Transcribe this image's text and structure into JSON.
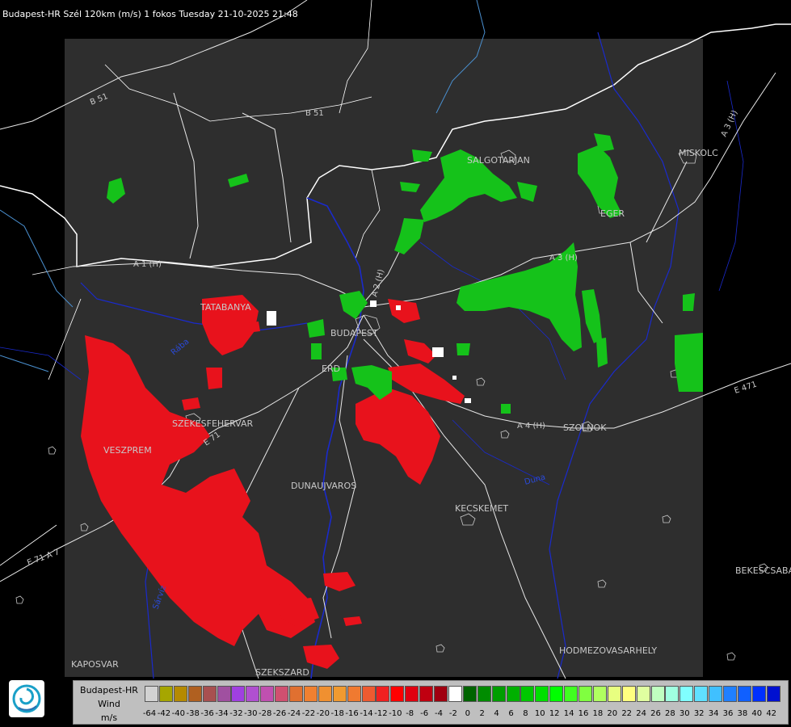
{
  "header": {
    "title": "Budapest-HR Szél 120km (m/s) 1 fokos Tuesday 21-10-2025 21:48"
  },
  "map": {
    "background_color": "#000000",
    "radar_area_color": "#2e2e2e",
    "road_color": "#e8e8e8",
    "river_color": "#1a2acc",
    "border_color": "#ffffff",
    "cities": [
      {
        "id": "salgotarjan",
        "label": "SALGOTARJAN"
      },
      {
        "id": "miskolc",
        "label": "MISKOLC"
      },
      {
        "id": "eger",
        "label": "EGER"
      },
      {
        "id": "tatabanya",
        "label": "TATABANYA"
      },
      {
        "id": "budapest",
        "label": "BUDAPEST"
      },
      {
        "id": "erd",
        "label": "ERD"
      },
      {
        "id": "szekesfehervar",
        "label": "SZEKESFEHERVAR"
      },
      {
        "id": "veszprem",
        "label": "VESZPREM"
      },
      {
        "id": "dunaujvaros",
        "label": "DUNAUJVAROS"
      },
      {
        "id": "kecskemet",
        "label": "KECSKEMET"
      },
      {
        "id": "szolnok",
        "label": "SZOLNOK"
      },
      {
        "id": "bekescsaba",
        "label": "BEKESCSABA"
      },
      {
        "id": "hodmezovasarhely",
        "label": "HODMEZOVASARHELY"
      },
      {
        "id": "kaposvar",
        "label": "KAPOSVAR"
      },
      {
        "id": "szekszard",
        "label": "SZEKSZARD"
      }
    ],
    "roads": [
      {
        "id": "b51-west",
        "label": "B 51"
      },
      {
        "id": "b51-east",
        "label": "B 51"
      },
      {
        "id": "a1",
        "label": "A 1 (H)"
      },
      {
        "id": "a2",
        "label": "A 2 (H)"
      },
      {
        "id": "a3",
        "label": "A 3 (H)"
      },
      {
        "id": "a3-ne",
        "label": "A 3 (H)"
      },
      {
        "id": "a4",
        "label": "A 4 (H)"
      },
      {
        "id": "e71",
        "label": "E 71"
      },
      {
        "id": "e71-sw",
        "label": "E 71 A 7"
      },
      {
        "id": "e471",
        "label": "E 471"
      }
    ],
    "rivers": [
      {
        "id": "raba",
        "label": "Rába"
      },
      {
        "id": "sarviz",
        "label": "Sárvíz"
      },
      {
        "id": "duna",
        "label": "Duna"
      }
    ]
  },
  "legend": {
    "line1": "Budapest-HR",
    "line2": "Wind",
    "line3": "m/s",
    "ticks": [
      "-64",
      "-42",
      "-40",
      "-38",
      "-36",
      "-34",
      "-32",
      "-30",
      "-28",
      "-26",
      "-24",
      "-22",
      "-20",
      "-18",
      "-16",
      "-14",
      "-12",
      "-10",
      "-8",
      "-6",
      "-4",
      "-2",
      "0",
      "2",
      "4",
      "6",
      "8",
      "10",
      "12",
      "14",
      "16",
      "18",
      "20",
      "22",
      "24",
      "26",
      "28",
      "30",
      "32",
      "34",
      "36",
      "38",
      "40",
      "42"
    ],
    "colors": [
      "#d2d2d2",
      "#a6a600",
      "#b58a00",
      "#b06020",
      "#a85050",
      "#a050a0",
      "#a040e0",
      "#b050d0",
      "#c050b0",
      "#d05070",
      "#e07030",
      "#f08030",
      "#f09030",
      "#f09a30",
      "#f07a30",
      "#ee5a30",
      "#f02020",
      "#ff0000",
      "#e00010",
      "#c00010",
      "#a00010",
      "#ffffff",
      "#006400",
      "#008c00",
      "#009e00",
      "#00b000",
      "#00c800",
      "#00e000",
      "#00ff00",
      "#40ff20",
      "#80ff40",
      "#b0ff60",
      "#e8ff80",
      "#ffff80",
      "#e0ffa0",
      "#c0ffc0",
      "#a0ffe0",
      "#80ffff",
      "#60e0ff",
      "#40c0ff",
      "#2080ff",
      "#1060ff",
      "#0030ff",
      "#0010d0"
    ]
  }
}
